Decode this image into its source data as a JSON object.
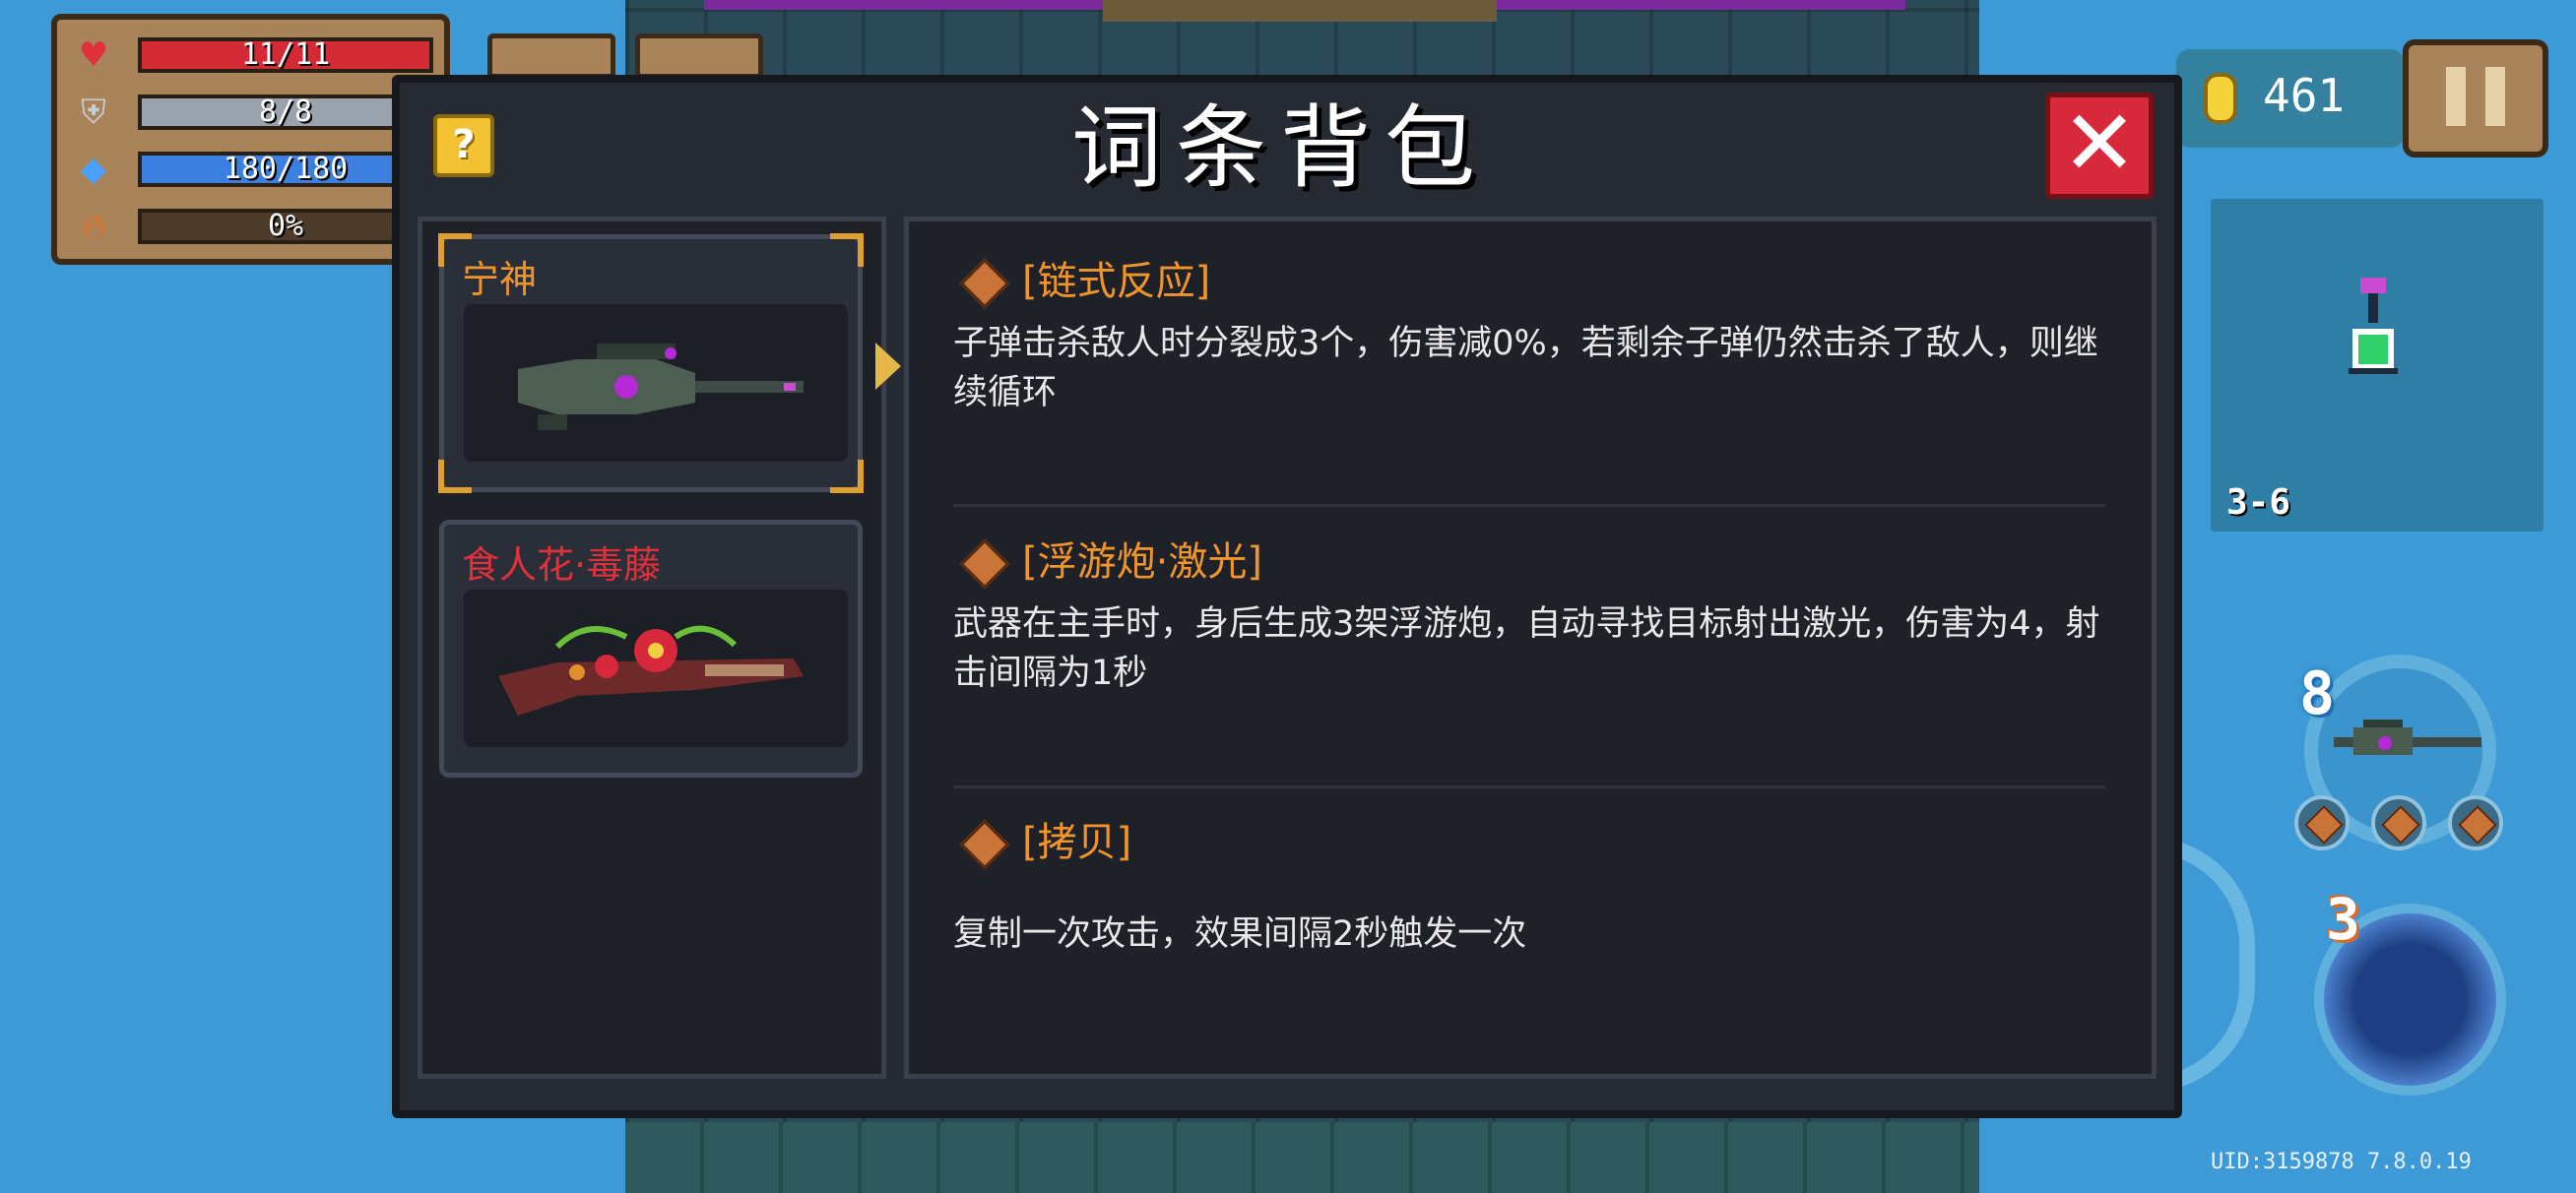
{
  "hud": {
    "health": {
      "text": "11/11",
      "fill": 1.0,
      "color": "#d42a35",
      "icon": "heart-icon"
    },
    "armor": {
      "text": "8/8",
      "fill": 1.0,
      "color": "#9aa3ad",
      "icon": "shield-icon"
    },
    "energy": {
      "text": "180/180",
      "fill": 1.0,
      "color": "#3b7fe0",
      "icon": "energy-crystal-icon"
    },
    "crit": {
      "text": "0%",
      "fill": 0.0,
      "color": "#e65a1a",
      "icon": "fire-icon"
    }
  },
  "gold": {
    "value": "461",
    "icon": "gold-coin-icon"
  },
  "pause": {
    "icon": "pause-icon"
  },
  "minimap": {
    "level": "3-6"
  },
  "weapon_slot": {
    "ammo_count": "8",
    "gem_icons": [
      "chain-gem-icon",
      "chain-gem-icon",
      "chain-gem-icon"
    ]
  },
  "skill": {
    "count": "3"
  },
  "uid_text": "UID:3159878 7.8.0.19",
  "dialog": {
    "title": "词条背包",
    "help_label": "?",
    "close_label": "✕",
    "items": [
      {
        "name": "宁神",
        "name_color": "#f0952e",
        "icon": "sniper-rifle-icon",
        "selected": true
      },
      {
        "name": "食人花·毒藤",
        "name_color": "#e0303a",
        "icon": "flower-vine-gun-icon",
        "selected": false
      }
    ],
    "entries": [
      {
        "title": "[链式反应]",
        "description": "子弹击杀敌人时分裂成3个，伤害减0%，若剩余子弹仍然击杀了敌人，则继续循环"
      },
      {
        "title": "[浮游炮·激光]",
        "description": "武器在主手时，身后生成3架浮游炮，自动寻找目标射出激光，伤害为4，射击间隔为1秒"
      },
      {
        "title": "[拷贝]",
        "description": "复制一次攻击，效果间隔2秒触发一次"
      }
    ]
  }
}
